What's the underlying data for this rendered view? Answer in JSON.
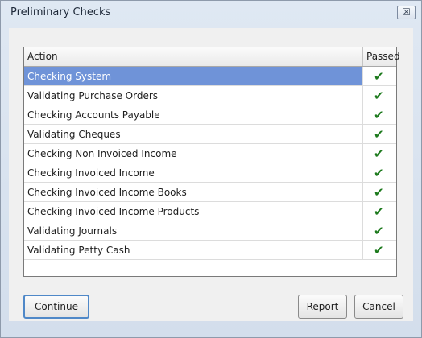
{
  "window": {
    "title": "Preliminary Checks",
    "close_glyph": "☒"
  },
  "grid": {
    "columns": [
      "Action",
      "Passed"
    ],
    "rows": [
      {
        "action": "Checking System",
        "passed": "✔"
      },
      {
        "action": "Validating Purchase Orders",
        "passed": "✔"
      },
      {
        "action": "Checking Accounts Payable",
        "passed": "✔"
      },
      {
        "action": "Validating Cheques",
        "passed": "✔"
      },
      {
        "action": "Checking Non Invoiced Income",
        "passed": "✔"
      },
      {
        "action": "Checking Invoiced Income",
        "passed": "✔"
      },
      {
        "action": "Checking Invoiced Income Books",
        "passed": "✔"
      },
      {
        "action": "Checking Invoiced Income Products",
        "passed": "✔"
      },
      {
        "action": "Validating Journals",
        "passed": "✔"
      },
      {
        "action": "Validating Petty Cash",
        "passed": "✔"
      }
    ]
  },
  "buttons": {
    "continue": "Continue",
    "report": "Report",
    "cancel": "Cancel"
  },
  "colors": {
    "selection": "#6f93d8",
    "check": "#1d7a1d"
  }
}
